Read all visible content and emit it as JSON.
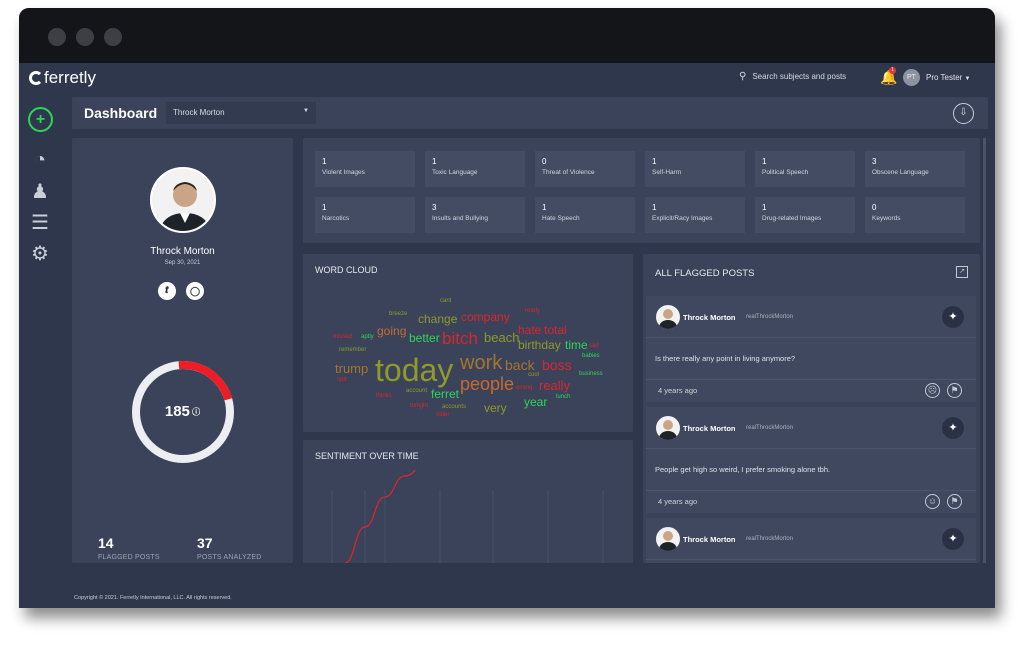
{
  "app": {
    "logo": "ferretly",
    "search_placeholder": "Search subjects and posts",
    "notification_count": "1",
    "user_initials": "PT",
    "user_name": "Pro Tester"
  },
  "sidebar": {
    "items": [
      {
        "icon": "plus-icon",
        "label": "add"
      },
      {
        "icon": "dashboard-gauge-icon"
      },
      {
        "icon": "user-icon"
      },
      {
        "icon": "list-icon"
      },
      {
        "icon": "gear-icon"
      }
    ]
  },
  "header": {
    "title": "Dashboard",
    "subject_select": "Throck Morton"
  },
  "profile": {
    "name": "Throck Morton",
    "date": "Sep 30, 2021",
    "score": "185",
    "risk_fraction": 0.22,
    "flagged_posts": "14",
    "flagged_label": "FLAGGED POSTS",
    "analyzed": "37",
    "analyzed_label": "POSTS ANALYZED"
  },
  "categories": [
    {
      "count": "1",
      "label": "Violent Images"
    },
    {
      "count": "1",
      "label": "Toxic Language"
    },
    {
      "count": "0",
      "label": "Threat of Violence"
    },
    {
      "count": "1",
      "label": "Self-Harm"
    },
    {
      "count": "1",
      "label": "Political Speech"
    },
    {
      "count": "3",
      "label": "Obscene Language"
    },
    {
      "count": "1",
      "label": "Narcotics"
    },
    {
      "count": "3",
      "label": "Insults and Bullying"
    },
    {
      "count": "1",
      "label": "Hate Speech"
    },
    {
      "count": "1",
      "label": "Explicit/Racy Images"
    },
    {
      "count": "1",
      "label": "Drug-related Images"
    },
    {
      "count": "0",
      "label": "Keywords"
    }
  ],
  "word_cloud": {
    "title": "WORD CLOUD",
    "colors": {
      "olive": "#8f9a2a",
      "red": "#d9262e",
      "green": "#2fd35a",
      "orange": "#c8692e",
      "brown": "#a3742f"
    },
    "words": [
      "cant",
      "breeze",
      "change",
      "company",
      "ready",
      "going",
      "better",
      "bitch",
      "beach",
      "hate",
      "total",
      "birthday",
      "time",
      "sad",
      "missed",
      "aptly",
      "remember",
      "today",
      "work",
      "back",
      "boss",
      "babies",
      "trump",
      "cool",
      "business",
      "spit",
      "people",
      "wrong",
      "really",
      "ferret",
      "account",
      "thinks",
      "year",
      "lunch",
      "very",
      "tonight",
      "accounts",
      "older"
    ]
  },
  "sentiment": {
    "title": "SENTIMENT OVER TIME",
    "line_color": "#d9262e",
    "values": [
      -1,
      -0.4,
      0.1,
      0.45,
      0.62,
      0.66,
      0.64,
      0.63,
      0.62,
      0.62,
      0.62,
      0.62,
      0.62,
      0.62
    ]
  },
  "flagged": {
    "title": "ALL FLAGGED POSTS",
    "posts": [
      {
        "name": "Throck Morton",
        "handle": "realThrockMorton",
        "text": "Is there really any point in living anymore?",
        "time": "4 years ago",
        "sentiment": "sad-face-icon"
      },
      {
        "name": "Throck Morton",
        "handle": "realThrockMorton",
        "text": "People get high so weird, I prefer smoking alone tbh.",
        "time": "4 years ago",
        "sentiment": "neutral-face-icon"
      },
      {
        "name": "Throck Morton",
        "handle": "realThrockMorton",
        "text": "",
        "time": ""
      }
    ]
  },
  "footer": {
    "copyright": "Copyright © 2021. Ferretly International, LLC. All rights reserved."
  }
}
